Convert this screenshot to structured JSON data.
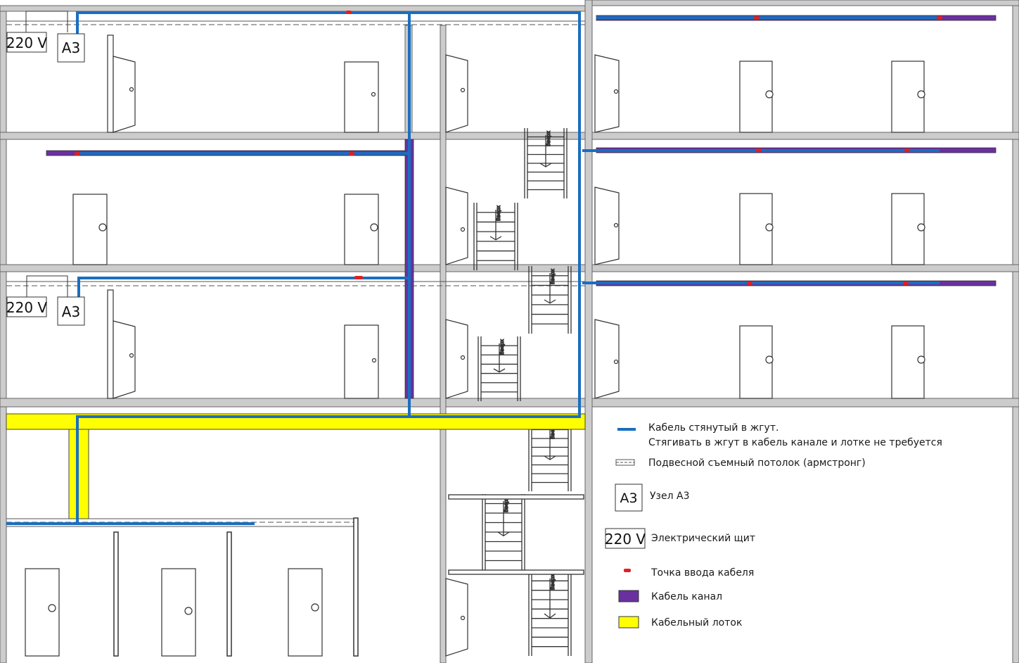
{
  "colors": {
    "cable": "#1a6ec0",
    "conduit": "#6a30a0",
    "tray": "#ffff00",
    "entry": "#e02020",
    "wall": "#cccccc",
    "outline": "#555555"
  },
  "labels": {
    "panel": "220 V",
    "node": "A3",
    "stair_up": "Вверх"
  },
  "legend": {
    "cable_line1": "Кабель стянутый в жгут.",
    "cable_line2": "Стягивать в жгут в кабель канале и лотке не требуется",
    "ceiling": "Подвесной съемный потолок (армстронг)",
    "node": "Узел А3",
    "panel": "Электрический щит",
    "entry": "Точка ввода кабеля",
    "conduit": "Кабель канал",
    "tray": "Кабельный лоток"
  }
}
